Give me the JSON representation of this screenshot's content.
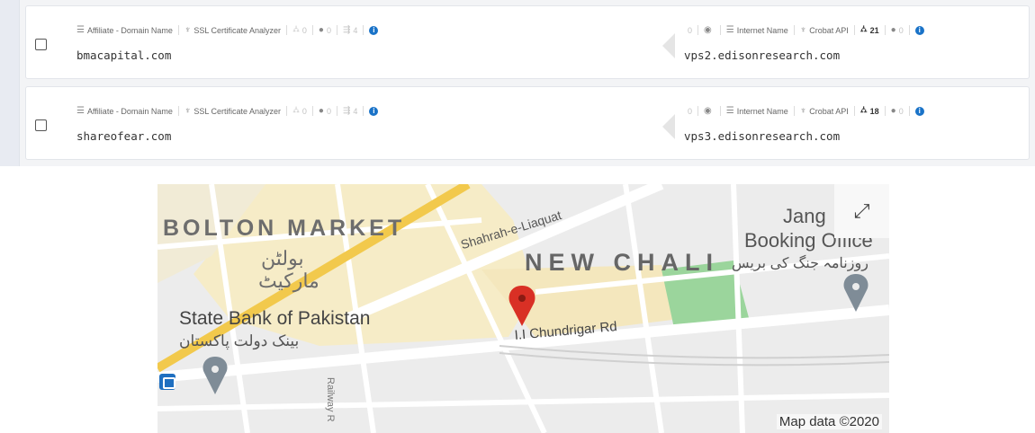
{
  "rows": [
    {
      "domain": "bmacapital.com",
      "meta": {
        "source_type": "Affiliate - Domain Name",
        "module": "SSL Certificate Analyzer",
        "children": "0",
        "count2": "0",
        "count3": "4"
      },
      "linked": {
        "domain": "vps2.edisonresearch.com",
        "c1": "0",
        "type": "Internet Name",
        "module": "Crobat API",
        "children": "21",
        "count2": "0"
      }
    },
    {
      "domain": "shareofear.com",
      "meta": {
        "source_type": "Affiliate - Domain Name",
        "module": "SSL Certificate Analyzer",
        "children": "0",
        "count2": "0",
        "count3": "4"
      },
      "linked": {
        "domain": "vps3.edisonresearch.com",
        "c1": "0",
        "type": "Internet Name",
        "module": "Crobat API",
        "children": "18",
        "count2": "0"
      }
    }
  ],
  "map": {
    "labels": {
      "bolton": "BOLTON MARKET",
      "bolton_urdu_1": "بولٹن",
      "bolton_urdu_2": "مارکیٹ",
      "shahrah": "Shahrah-e-Liaquat",
      "new_chali": "NEW CHALI",
      "jang_1": "Jang",
      "jang_2": "Booking Office",
      "jang_3": "روزنامہ جنگ کی بریس",
      "sbp": "State Bank of Pakistan",
      "sbp_urdu": "بینک دولت پاکستان",
      "road": "I.I Chundrigar Rd",
      "railway": "Railway R"
    },
    "attribution": "Map data ©2020",
    "fullscreen_icon": "expand-icon"
  },
  "colors": {
    "info_badge": "#1a73c8",
    "map_pin": "#d93025",
    "highway": "#f2c94c",
    "park": "#9bd59c"
  }
}
